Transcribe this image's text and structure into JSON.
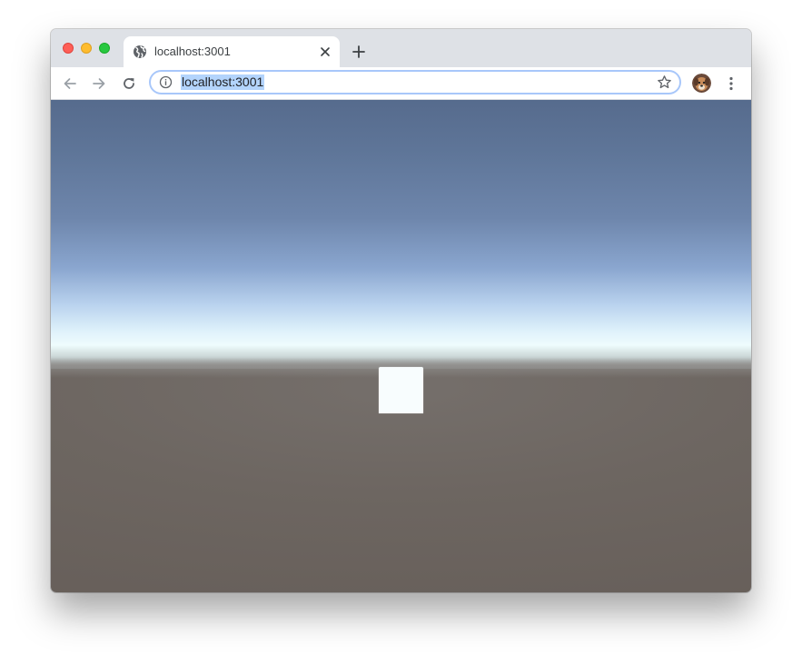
{
  "window": {
    "traffic_lights": [
      "close",
      "minimize",
      "maximize"
    ]
  },
  "tab": {
    "title": "localhost:3001",
    "favicon_icon": "globe-icon",
    "close_icon": "close-icon"
  },
  "new_tab_icon": "plus-icon",
  "toolbar": {
    "back_icon": "arrow-left-icon",
    "forward_icon": "arrow-right-icon",
    "reload_icon": "reload-icon",
    "address": "localhost:3001",
    "info_icon": "info-icon",
    "bookmark_icon": "star-icon",
    "profile_icon": "avatar",
    "menu_icon": "kebab-icon"
  },
  "colors": {
    "sky_top": "#566b8d",
    "horizon": "#eefcfd",
    "ground": "#6d6661",
    "cube": "#f8fdfe",
    "selection": "#b3d4fc"
  }
}
